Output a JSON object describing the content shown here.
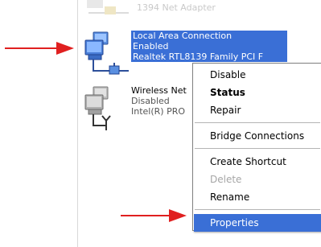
{
  "ghost_item": {
    "label": "1394 Net Adapter"
  },
  "connections": [
    {
      "name": "Local Area Connection",
      "status": "Enabled",
      "device": "Realtek RTL8139 Family PCI F"
    },
    {
      "name": "Wireless Net",
      "status": "Disabled",
      "device": "Intel(R) PRO"
    }
  ],
  "context_menu": {
    "items": [
      {
        "label": "Disable"
      },
      {
        "label": "Status"
      },
      {
        "label": "Repair"
      },
      {
        "label": "Bridge Connections"
      },
      {
        "label": "Create Shortcut"
      },
      {
        "label": "Delete"
      },
      {
        "label": "Rename"
      },
      {
        "label": "Properties"
      }
    ]
  },
  "colors": {
    "selection": "#3a6fd6",
    "annotation_arrow": "#e02020",
    "disabled_text": "#a6a6a6"
  },
  "icons": {
    "lan": "network-connection-icon",
    "wireless": "wireless-connection-icon",
    "arrow": "red-arrow-icon"
  }
}
